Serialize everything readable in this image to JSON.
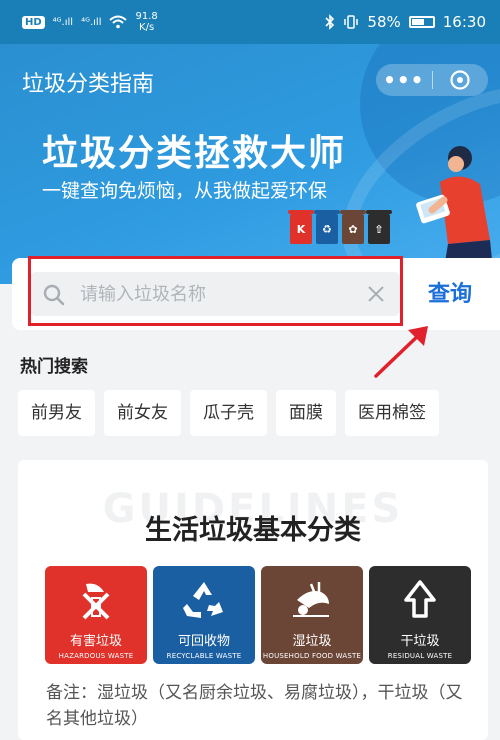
{
  "status_bar": {
    "hd": "HD",
    "signal_1": "⁴ᴳ.ıll",
    "signal_2": "⁴ᴳ.ıll",
    "speed_value": "91.8",
    "speed_unit": "K/s",
    "battery": "58%",
    "time": "16:30"
  },
  "header": {
    "title": "垃圾分类指南",
    "more": "•••"
  },
  "banner": {
    "headline": "垃圾分类拯救大师",
    "subline": "一键查询免烦恼，从我做起爱环保"
  },
  "search": {
    "placeholder": "请输入垃圾名称",
    "value": "",
    "button": "查询"
  },
  "hot": {
    "title": "热门搜索",
    "items": [
      "前男友",
      "前女友",
      "瓜子壳",
      "面膜",
      "医用棉签"
    ]
  },
  "guide": {
    "watermark": "GUIDELINES",
    "title": "生活垃圾基本分类",
    "categories": [
      {
        "cn": "有害垃圾",
        "en": "HAZARDOUS WASTE",
        "color": "#e0312a"
      },
      {
        "cn": "可回收物",
        "en": "RECYCLABLE WASTE",
        "color": "#1b5fa3"
      },
      {
        "cn": "湿垃圾",
        "en": "HOUSEHOLD FOOD WASTE",
        "color": "#6b4536"
      },
      {
        "cn": "干垃圾",
        "en": "RESIDUAL WASTE",
        "color": "#2d2d2d"
      }
    ],
    "note": "备注：湿垃圾（又名厨余垃圾、易腐垃圾），干垃圾（又名其他垃圾）"
  },
  "colors": {
    "status_bar": "#1b7fb7",
    "accent": "#1a6fd8",
    "highlight": "#e0202a"
  }
}
